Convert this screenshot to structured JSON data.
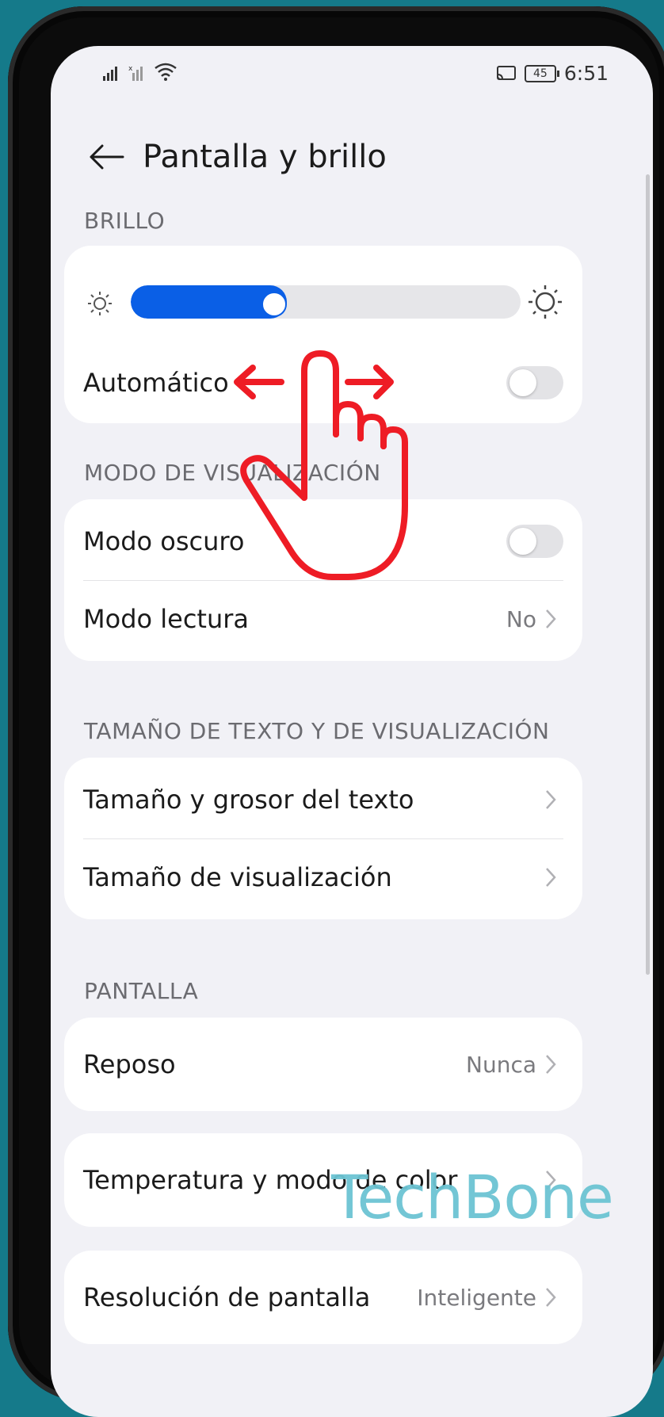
{
  "status_bar": {
    "time": "6:51",
    "battery": "45"
  },
  "header": {
    "title": "Pantalla y brillo"
  },
  "sections": {
    "brillo": "BRILLO",
    "modo_visualizacion": "MODO DE VISUALIZACIÓN",
    "tamano_texto": "TAMAÑO DE TEXTO Y DE VISUALIZACIÓN",
    "pantalla": "PANTALLA"
  },
  "brightness": {
    "level": 0.4,
    "auto_label": "Automático",
    "auto_enabled": false
  },
  "items": {
    "modo_oscuro": {
      "label": "Modo oscuro",
      "enabled": false
    },
    "modo_lectura": {
      "label": "Modo lectura",
      "value": "No"
    },
    "tamano_grosor": {
      "label": "Tamaño y grosor del texto"
    },
    "tamano_visualizacion": {
      "label": "Tamaño de visualización"
    },
    "reposo": {
      "label": "Reposo",
      "value": "Nunca"
    },
    "temperatura": {
      "label": "Temperatura y modo de color"
    },
    "resolucion": {
      "label": "Resolución de pantalla",
      "value": "Inteligente"
    }
  },
  "watermark": "TechBone",
  "colors": {
    "accent": "#0a5fe6",
    "gesture": "#ee1c25",
    "background": "#157a8a"
  }
}
